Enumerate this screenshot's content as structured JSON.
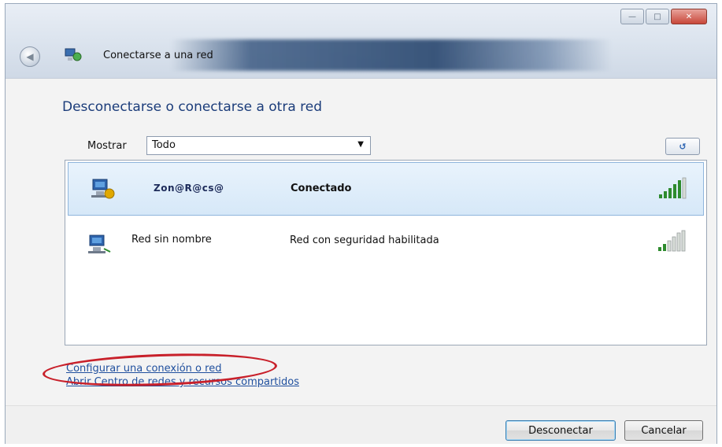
{
  "window": {
    "title": "Conectarse a una red"
  },
  "main": {
    "heading": "Desconectarse o conectarse a otra red",
    "show_label": "Mostrar",
    "show_value": "Todo"
  },
  "networks": [
    {
      "name": "Zon@R@cs@",
      "status": "Conectado",
      "selected": true
    },
    {
      "name": "Red sin nombre",
      "status": "Red con seguridad habilitada",
      "selected": false
    }
  ],
  "links": {
    "setup": "Configurar una conexión o red",
    "center": "Abrir Centro de redes y recursos compartidos"
  },
  "buttons": {
    "disconnect": "Desconectar",
    "cancel": "Cancelar"
  },
  "colors": {
    "accent": "#1b3c7a",
    "link": "#1f4f9e",
    "signal": "#2e8b2e",
    "annotation": "#c8202a"
  }
}
